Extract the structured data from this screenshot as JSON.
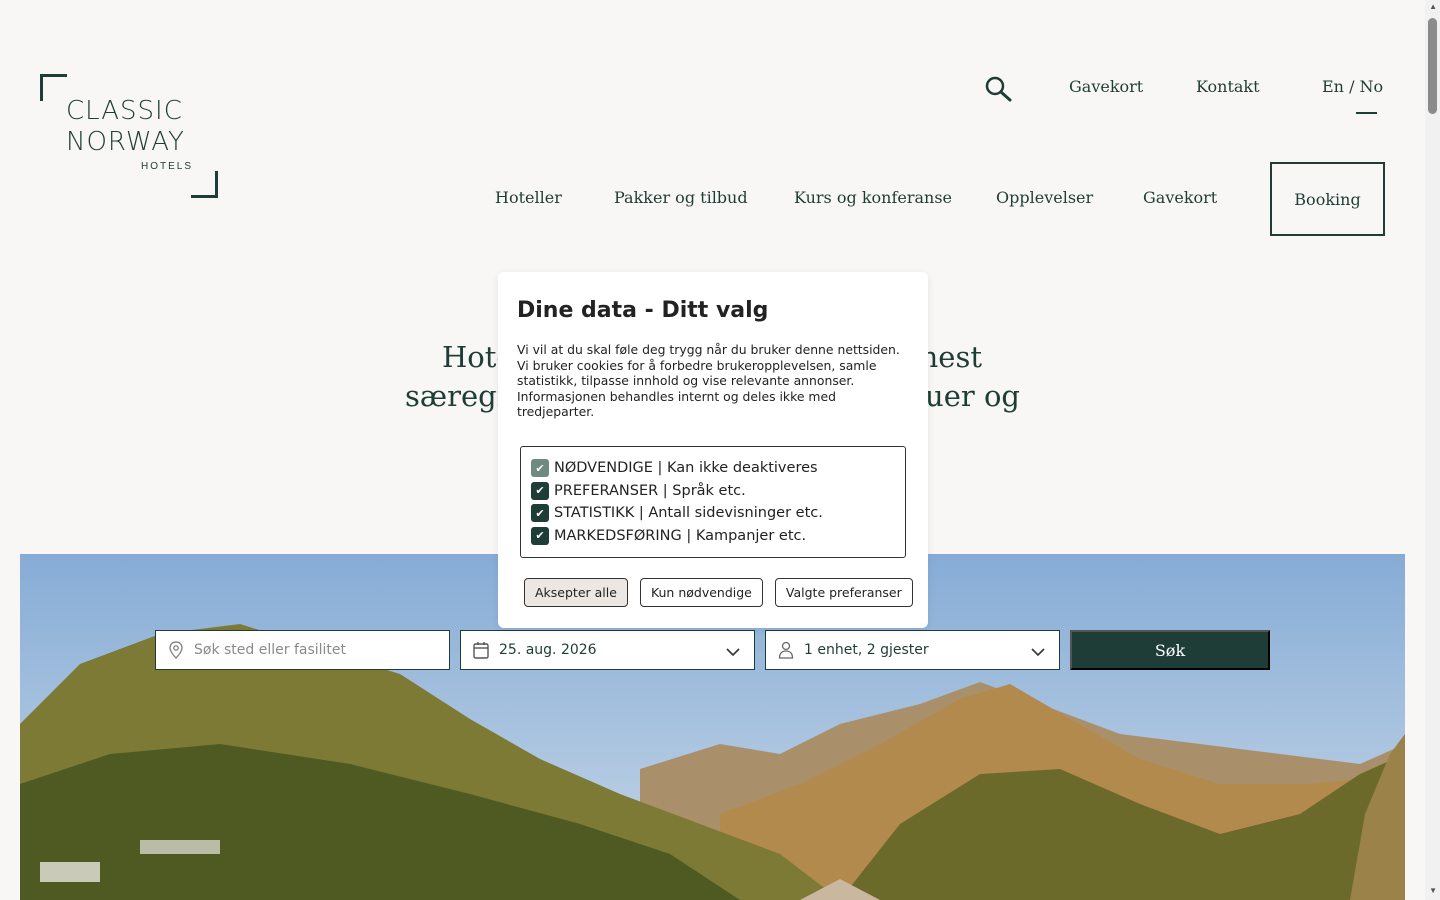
{
  "brand": {
    "line1": "CLASSIC",
    "line2": "NORWAY",
    "line3": "HOTELS"
  },
  "util_nav": {
    "gavekort": "Gavekort",
    "kontakt": "Kontakt",
    "language": "En / No"
  },
  "main_nav": {
    "items": [
      "Hoteller",
      "Pakker og tilbud",
      "Kurs og konferanse",
      "Opplevelser",
      "Gavekort"
    ],
    "booking": "Booking"
  },
  "hero": {
    "heading_line1": "Hote",
    "heading_line1_end": "nest",
    "heading_line2": "særegn",
    "heading_line2_end": "ouer og"
  },
  "search": {
    "place_placeholder": "Søk sted eller fasilitet",
    "date_value": "25. aug. 2026",
    "guests_value": "1 enhet, 2 gjester",
    "submit": "Søk"
  },
  "cookie": {
    "title": "Dine data - Ditt valg",
    "description": "Vi vil at du skal føle deg trygg når du bruker denne nettsiden. Vi bruker cookies for å forbedre brukeropplevelsen, samle statistikk, tilpasse innhold og vise relevante annonser. Informasjonen behandles internt og deles ikke med tredjeparter.",
    "options": [
      {
        "label": "NØDVENDIGE | Kan ikke deaktiveres",
        "checked": true,
        "disabled": true
      },
      {
        "label": "PREFERANSER | Språk etc.",
        "checked": true,
        "disabled": false
      },
      {
        "label": "STATISTIKK | Antall sidevisninger etc.",
        "checked": true,
        "disabled": false
      },
      {
        "label": "MARKEDSFØRING | Kampanjer etc.",
        "checked": true,
        "disabled": false
      }
    ],
    "accept_all": "Aksepter alle",
    "only_necessary": "Kun nødvendige",
    "selected_prefs": "Valgte preferanser"
  },
  "colors": {
    "brand": "#1e3d36",
    "background": "#f8f7f5"
  }
}
